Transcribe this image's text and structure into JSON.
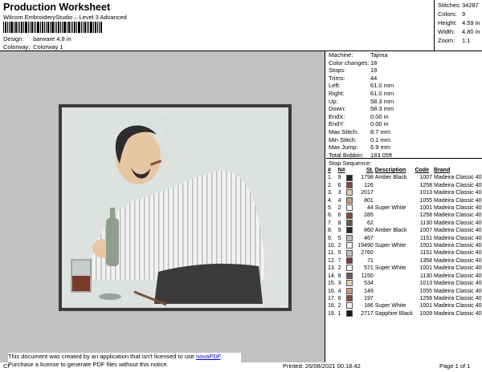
{
  "header": {
    "title": "Production Worksheet",
    "subtitle": "Wilcom EmbroideryStudio – Level 3 Advanced",
    "design_label": "Design:",
    "design_value": "barware 4,8 in",
    "colorway_label": "Colorway:",
    "colorway_value": "Colorway 1"
  },
  "stats": [
    {
      "label": "Stitches:",
      "value": "34287"
    },
    {
      "label": "Colors:",
      "value": "9"
    },
    {
      "label": "Height:",
      "value": "4.59 in"
    },
    {
      "label": "Width:",
      "value": "4.80 in"
    },
    {
      "label": "Zoom:",
      "value": "1:1"
    }
  ],
  "machine_info": [
    {
      "label": "Machine:",
      "value": "Tajima"
    },
    {
      "label": "Color changes:",
      "value": "18"
    },
    {
      "label": "Stops:",
      "value": "19"
    },
    {
      "label": "Trims:",
      "value": "44"
    },
    {
      "label": "Left:",
      "value": "61.0 mm"
    },
    {
      "label": "Right:",
      "value": "61.0 mm"
    },
    {
      "label": "Up:",
      "value": "58.3 mm"
    },
    {
      "label": "Down:",
      "value": "58.3 mm"
    },
    {
      "label": "EndX:",
      "value": "0.00 in"
    },
    {
      "label": "EndY:",
      "value": "0.00 in"
    },
    {
      "label": "Max Stitch:",
      "value": "8.7 mm"
    },
    {
      "label": "Min Stitch:",
      "value": "0.1 mm"
    },
    {
      "label": "Max Jump:",
      "value": "6.9 mm"
    },
    {
      "label": "Total Bobbin:",
      "value": "183.05ft"
    }
  ],
  "stop_sequence": {
    "title": "Stop Sequence:",
    "headers": [
      "#",
      "N#",
      "St.",
      "Description",
      "Code",
      "Brand"
    ],
    "rows": [
      {
        "idx": "1.",
        "n": "9",
        "color": "#2a2a2a",
        "st": "1798",
        "desc": "Amber Black",
        "code": "1007",
        "brand": "Madeira Classic 40"
      },
      {
        "idx": "2.",
        "n": "6",
        "color": "#8a4a3a",
        "st": "126",
        "desc": "",
        "code": "1258",
        "brand": "Madeira Classic 40"
      },
      {
        "idx": "3.",
        "n": "3",
        "color": "#e8c8a8",
        "st": "2017",
        "desc": "",
        "code": "1013",
        "brand": "Madeira Classic 40"
      },
      {
        "idx": "4.",
        "n": "4",
        "color": "#c89a78",
        "st": "801",
        "desc": "",
        "code": "1055",
        "brand": "Madeira Classic 40"
      },
      {
        "idx": "5.",
        "n": "2",
        "color": "#f4f4f4",
        "st": "44",
        "desc": "Super White",
        "code": "1001",
        "brand": "Madeira Classic 40"
      },
      {
        "idx": "6.",
        "n": "6",
        "color": "#8a4a3a",
        "st": "285",
        "desc": "",
        "code": "1258",
        "brand": "Madeira Classic 40"
      },
      {
        "idx": "7.",
        "n": "8",
        "color": "#6a5a50",
        "st": "62",
        "desc": "",
        "code": "1130",
        "brand": "Madeira Classic 40"
      },
      {
        "idx": "8.",
        "n": "9",
        "color": "#2a2a2a",
        "st": "860",
        "desc": "Amber Black",
        "code": "1007",
        "brand": "Madeira Classic 40"
      },
      {
        "idx": "9.",
        "n": "5",
        "color": "#b8c0c0",
        "st": "467",
        "desc": "",
        "code": "1151",
        "brand": "Madeira Classic 40"
      },
      {
        "idx": "10.",
        "n": "2",
        "color": "#f4f4f4",
        "st": "19490",
        "desc": "Super White",
        "code": "1001",
        "brand": "Madeira Classic 40"
      },
      {
        "idx": "11.",
        "n": "5",
        "color": "#b8c0c0",
        "st": "2760",
        "desc": "",
        "code": "1151",
        "brand": "Madeira Classic 40"
      },
      {
        "idx": "12.",
        "n": "7",
        "color": "#7a3a40",
        "st": "71",
        "desc": "",
        "code": "1358",
        "brand": "Madeira Classic 40"
      },
      {
        "idx": "13.",
        "n": "2",
        "color": "#f4f4f4",
        "st": "571",
        "desc": "Super White",
        "code": "1001",
        "brand": "Madeira Classic 40"
      },
      {
        "idx": "14.",
        "n": "8",
        "color": "#6a5a50",
        "st": "1150",
        "desc": "",
        "code": "1130",
        "brand": "Madeira Classic 40"
      },
      {
        "idx": "15.",
        "n": "3",
        "color": "#e8c8a8",
        "st": "534",
        "desc": "",
        "code": "1013",
        "brand": "Madeira Classic 40"
      },
      {
        "idx": "16.",
        "n": "4",
        "color": "#c89a78",
        "st": "149",
        "desc": "",
        "code": "1055",
        "brand": "Madeira Classic 40"
      },
      {
        "idx": "17.",
        "n": "6",
        "color": "#8a4a3a",
        "st": "197",
        "desc": "",
        "code": "1258",
        "brand": "Madeira Classic 40"
      },
      {
        "idx": "18.",
        "n": "2",
        "color": "#f4f4f4",
        "st": "186",
        "desc": "Super White",
        "code": "1001",
        "brand": "Madeira Classic 40"
      },
      {
        "idx": "19.",
        "n": "1",
        "color": "#1a1a1a",
        "st": "2717",
        "desc": "Sapphire Black",
        "code": "1009",
        "brand": "Madeira Classic 40"
      }
    ]
  },
  "footer": {
    "notice_line1": "This document was created by an application that isn't licensed to use ",
    "notice_link": "novaPDF",
    "notice_line1_end": ".",
    "notice_line2": "Purchase a license to generate PDF files without this notice.",
    "left_text": "Cr",
    "printed": "Printed: 26/08/2021 00.18.42",
    "page": "Page 1 of 1"
  }
}
